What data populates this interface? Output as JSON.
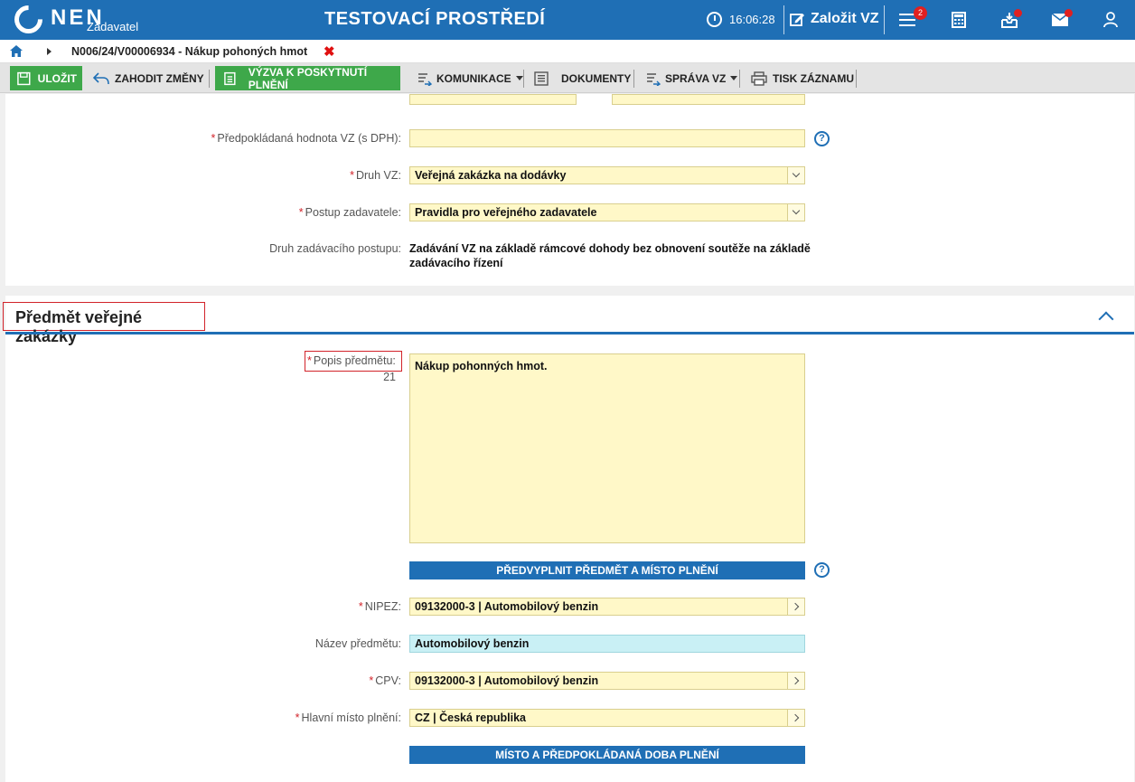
{
  "topbar": {
    "logo_text": "NEN",
    "logo_sub": "Zadavatel",
    "env_title": "TESTOVACÍ PROSTŘEDÍ",
    "time": "16:06:28",
    "new_vz": "Založit VZ",
    "menu_badge": "2",
    "accent": "#1f6fb5"
  },
  "breadcrumb": {
    "text": "N006/24/V00006934 - Nákup pohoných hmot",
    "close": "✖"
  },
  "toolbar": {
    "save": "ULOŽIT",
    "discard": "ZAHODIT ZMĚNY",
    "call": "VÝZVA K POSKYTNUTÍ PLNĚNÍ",
    "communication": "KOMUNIKACE",
    "documents": "DOKUMENTY",
    "management": "SPRÁVA VZ",
    "print": "TISK ZÁZNAMU"
  },
  "form": {
    "value_label": "Předpokládaná hodnota VZ (s DPH):",
    "value": "",
    "kind_label": "Druh VZ:",
    "kind": "Veřejná zakázka na dodávky",
    "procedure_label": "Postup zadavatele:",
    "procedure": "Pravidla pro veřejného zadavatele",
    "award_label": "Druh zadávacího postupu:",
    "award_line1": "Zadávání VZ na základě rámcové dohody bez obnovení soutěže na základě",
    "award_line2": "zadávacího řízení"
  },
  "subject": {
    "section_title": "Předmět veřejné zakázky",
    "desc_label": "Popis předmětu:",
    "desc_count": "21",
    "desc_value": "Nákup pohonných hmot.",
    "prefill_btn": "PŘEDVYPLNIT PŘEDMĚT A MÍSTO PLNĚNÍ",
    "nipez_label": "NIPEZ:",
    "nipez": "09132000-3 | Automobilový benzin",
    "name_label": "Název předmětu:",
    "name": "Automobilový benzin",
    "cpv_label": "CPV:",
    "cpv": "09132000-3 | Automobilový benzin",
    "place_label": "Hlavní místo plnění:",
    "place": "CZ | Česká republika",
    "place_btn": "MÍSTO A PŘEDPOKLÁDANÁ DOBA PLNĚNÍ",
    "help": "?"
  }
}
